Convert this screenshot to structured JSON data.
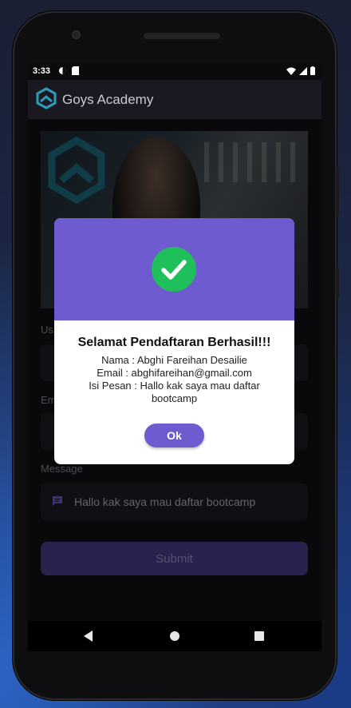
{
  "status_bar": {
    "time": "3:33"
  },
  "app_bar": {
    "title": "Goys Academy"
  },
  "form": {
    "username_label": "Us",
    "email_label": "Em",
    "message_label": "Message",
    "message_value": "Hallo kak saya mau daftar bootcamp",
    "submit_label": "Submit"
  },
  "dialog": {
    "title": "Selamat Pendaftaran Berhasil!!!",
    "name_line": "Nama : Abghi Fareihan Desailie",
    "email_line": "Email : abghifareihan@gmail.com",
    "message_line_1": "Isi Pesan : Hallo kak saya mau daftar",
    "message_line_2": "bootcamp",
    "ok_label": "Ok"
  },
  "colors": {
    "accent": "#6f5bd0",
    "success": "#1fbf5c",
    "submit_bg": "#4b3f8f",
    "app_bg": "#121117"
  },
  "icons": [
    "wifi-icon",
    "signal-icon",
    "battery-icon",
    "hexagon-logo-icon",
    "message-icon",
    "check-icon",
    "back-icon",
    "home-icon",
    "recent-apps-icon"
  ]
}
